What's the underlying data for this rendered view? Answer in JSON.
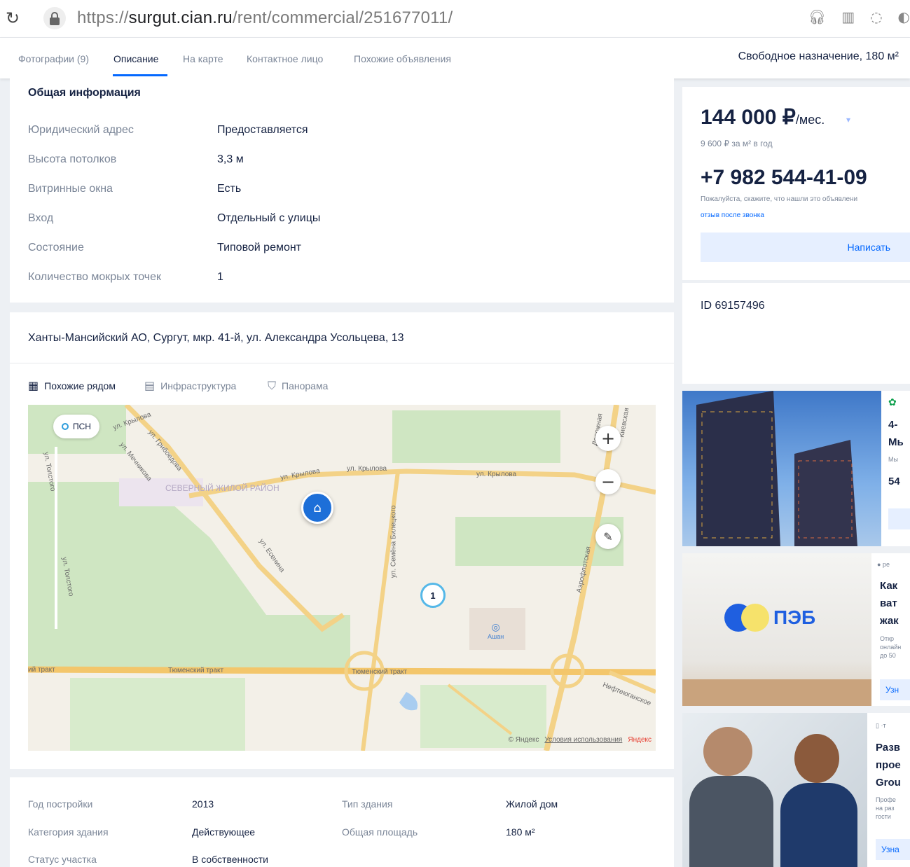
{
  "browser": {
    "url_scheme": "https://",
    "url_host": "surgut.cian.ru",
    "url_path": "/rent/commercial/251677011/",
    "icons": [
      "reload-icon",
      "lock-icon",
      "headphones-icon",
      "reader-icon",
      "chat-icon",
      "extension-icon"
    ]
  },
  "nav": {
    "tabs": [
      {
        "label": "Фотографии (9)"
      },
      {
        "label": "Описание"
      },
      {
        "label": "На карте"
      },
      {
        "label": "Контактное лицо"
      },
      {
        "label": "Похожие объявления"
      }
    ],
    "active_tab": "Описание",
    "listing_title": "Свободное назначение, 180 м²"
  },
  "general_info": {
    "title": "Общая информация",
    "rows": [
      {
        "label": "Юридический адрес",
        "value": "Предоставляется"
      },
      {
        "label": "Высота потолков",
        "value": "3,3 м"
      },
      {
        "label": "Витринные окна",
        "value": "Есть"
      },
      {
        "label": "Вход",
        "value": "Отдельный с улицы"
      },
      {
        "label": "Состояние",
        "value": "Типовой ремонт"
      },
      {
        "label": "Количество мокрых точек",
        "value": "1"
      }
    ]
  },
  "location": {
    "address": "Ханты-Мансийский АО, Сургут, мкр. 41-й, ул. Александра Усольцева, 13",
    "map_tabs": [
      {
        "label": "Похожие рядом",
        "icon": "grid-icon"
      },
      {
        "label": "Инфраструктура",
        "icon": "building-icon"
      },
      {
        "label": "Панорама",
        "icon": "panorama-icon"
      }
    ],
    "map": {
      "chip": "ПСН",
      "district": "СЕВЕРНЫЙ ЖИЛОЙ РАЙОН",
      "cluster_count": "1",
      "poi": "Ашан",
      "streets": [
        "ул. Крылова",
        "ул. Крылова",
        "ул. Крылова",
        "ул. Крылова",
        "ул. Грибоедова",
        "ул. Мечникова",
        "ул. Толстого",
        "ул. Толстого",
        "ул. Есенина",
        "ул. Семёна Билецкого",
        "Аэрофлотская",
        "Тюменский тракт",
        "Тюменский тракт",
        "ий тракт",
        "Нефтеюганское",
        "Киевская",
        "Дорожная"
      ],
      "zoom_in": "+",
      "zoom_out": "−",
      "footer_copyright": "© Яндекс",
      "footer_terms": "Условия использования",
      "footer_brand": "Яндекс"
    }
  },
  "building": {
    "rows": [
      {
        "label": "Год постройки",
        "value": "2013",
        "label2": "Тип здания",
        "value2": "Жилой дом"
      },
      {
        "label": "Категория здания",
        "value": "Действующее",
        "label2": "Общая площадь",
        "value2": "180 м²"
      },
      {
        "label": "Статус участка",
        "value": "В собственности"
      }
    ]
  },
  "sidebar": {
    "price": "144 000 ₽",
    "price_unit": "/мес.",
    "price_per_meter": "9 600 ₽ за м² в год",
    "phone": "+7 982 544-41-09",
    "phone_note": "Пожалуйста, скажите, что нашли это объявлени",
    "phone_note_link": "отзыв после звонка",
    "write_button": "Написать",
    "listing_id": "ID 69157496"
  },
  "ads": [
    {
      "line1": "4-",
      "line2": "Мь",
      "small": "Мы",
      "line3": "54"
    },
    {
      "small_top": "● ре",
      "line1": "Как",
      "line2": "ват",
      "line3": "жак",
      "small": "Откр\nонлайн\nдо 50",
      "button": "Узн",
      "logo": "ПЭБ"
    },
    {
      "small_top": "▯ ·т",
      "line1": "Разв",
      "line2": "прое",
      "line3": "Grou",
      "small": "Профе\nна раз\nгости",
      "button": "Узна"
    }
  ]
}
